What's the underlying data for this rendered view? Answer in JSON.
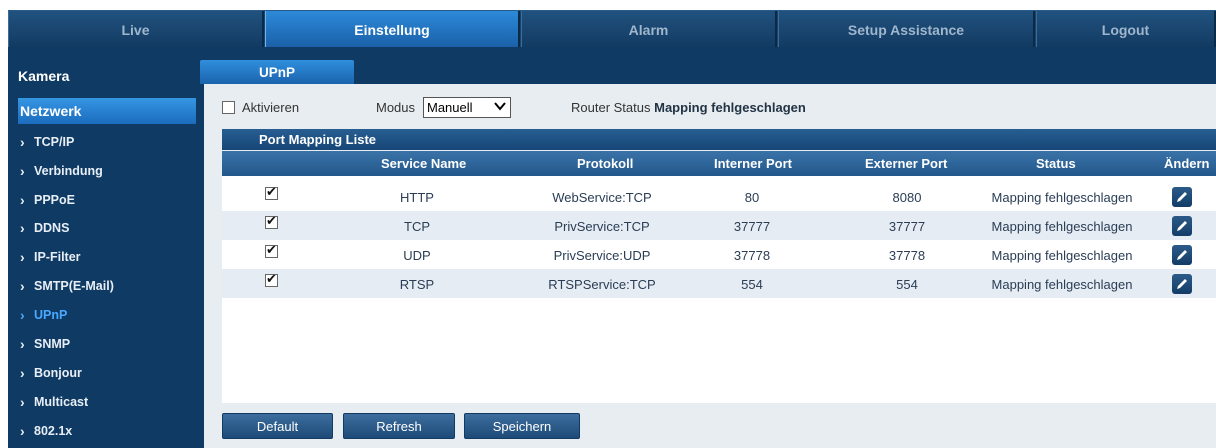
{
  "nav": {
    "tabs": [
      {
        "label": "Live",
        "active": false
      },
      {
        "label": "Einstellung",
        "active": true
      },
      {
        "label": "Alarm",
        "active": false
      },
      {
        "label": "Setup Assistance",
        "active": false
      },
      {
        "label": "Logout",
        "active": false
      }
    ]
  },
  "sidebar": {
    "kamera": "Kamera",
    "netzwerk": "Netzwerk",
    "items": [
      {
        "label": "TCP/IP",
        "active": false
      },
      {
        "label": "Verbindung",
        "active": false
      },
      {
        "label": "PPPoE",
        "active": false
      },
      {
        "label": "DDNS",
        "active": false
      },
      {
        "label": "IP-Filter",
        "active": false
      },
      {
        "label": "SMTP(E-Mail)",
        "active": false
      },
      {
        "label": "UPnP",
        "active": true
      },
      {
        "label": "SNMP",
        "active": false
      },
      {
        "label": "Bonjour",
        "active": false
      },
      {
        "label": "Multicast",
        "active": false
      },
      {
        "label": "802.1x",
        "active": false
      }
    ]
  },
  "section_tab": "UPnP",
  "enable": {
    "label": "Aktivieren",
    "checked": false
  },
  "modus": {
    "label": "Modus",
    "value": "Manuell"
  },
  "router_status": {
    "label": "Router Status",
    "value": "Mapping fehlgeschlagen"
  },
  "port_mapping": {
    "title": "Port Mapping Liste",
    "columns": [
      "Service Name",
      "Protokoll",
      "Interner Port",
      "Externer Port",
      "Status",
      "Ändern"
    ],
    "rows": [
      {
        "checked": true,
        "service": "HTTP",
        "protocol": "WebService:TCP",
        "internal": "80",
        "external": "8080",
        "status": "Mapping fehlgeschlagen"
      },
      {
        "checked": true,
        "service": "TCP",
        "protocol": "PrivService:TCP",
        "internal": "37777",
        "external": "37777",
        "status": "Mapping fehlgeschlagen"
      },
      {
        "checked": true,
        "service": "UDP",
        "protocol": "PrivService:UDP",
        "internal": "37778",
        "external": "37778",
        "status": "Mapping fehlgeschlagen"
      },
      {
        "checked": true,
        "service": "RTSP",
        "protocol": "RTSPService:TCP",
        "internal": "554",
        "external": "554",
        "status": "Mapping fehlgeschlagen"
      }
    ]
  },
  "buttons": {
    "default": "Default",
    "refresh": "Refresh",
    "save": "Speichern"
  },
  "icons": {
    "sidebar_item": "chevron-right-icon",
    "edit": "pencil-icon",
    "modus_select": "chevron-down-icon"
  },
  "colors": {
    "nav_active": "#2c8ad9",
    "nav_bg": "#17436d",
    "sidebar_active_item": "#4aa8ff",
    "panel_bg": "#e8edf2"
  }
}
